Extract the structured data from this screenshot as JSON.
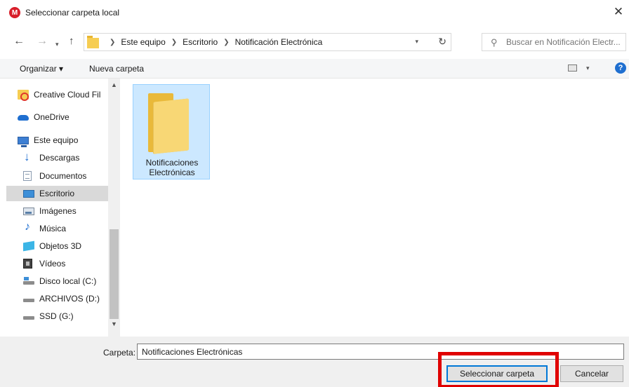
{
  "window": {
    "app_logo_letter": "M",
    "title": "Seleccionar carpeta local",
    "close_glyph": "✕"
  },
  "navigation": {
    "breadcrumbs": [
      "Este equipo",
      "Escritorio",
      "Notificación Electrónica"
    ],
    "search_placeholder": "Buscar en Notificación Electr..."
  },
  "toolbar": {
    "organize_label": "Organizar ▾",
    "new_folder_label": "Nueva carpeta",
    "help_glyph": "?"
  },
  "sidebar": {
    "items": [
      {
        "label": "Creative Cloud Fil",
        "icon": "creative-cloud-icon",
        "selected": false
      },
      {
        "label": "OneDrive",
        "icon": "onedrive-icon",
        "selected": false
      },
      {
        "label": "Este equipo",
        "icon": "this-pc-icon",
        "selected": false
      },
      {
        "label": "Descargas",
        "icon": "downloads-icon",
        "selected": false
      },
      {
        "label": "Documentos",
        "icon": "documents-icon",
        "selected": false
      },
      {
        "label": "Escritorio",
        "icon": "desktop-icon",
        "selected": true
      },
      {
        "label": "Imágenes",
        "icon": "pictures-icon",
        "selected": false
      },
      {
        "label": "Música",
        "icon": "music-icon",
        "selected": false
      },
      {
        "label": "Objetos 3D",
        "icon": "3d-objects-icon",
        "selected": false
      },
      {
        "label": "Vídeos",
        "icon": "videos-icon",
        "selected": false
      },
      {
        "label": "Disco local (C:)",
        "icon": "local-disk-icon",
        "selected": false
      },
      {
        "label": "ARCHIVOS (D:)",
        "icon": "drive-icon",
        "selected": false
      },
      {
        "label": "SSD (G:)",
        "icon": "drive-icon",
        "selected": false
      }
    ]
  },
  "content": {
    "items": [
      {
        "label": "Notificaciones Electrónicas",
        "icon": "folder-icon",
        "selected": true
      }
    ]
  },
  "footer": {
    "folder_label": "Carpeta:",
    "folder_value": "Notificaciones Electrónicas",
    "select_button": "Seleccionar carpeta",
    "cancel_button": "Cancelar"
  },
  "colors": {
    "selection_bg": "#cce8ff",
    "selection_border": "#99d1ff",
    "highlight_annotation": "#e00000",
    "default_button_border": "#0078d7"
  }
}
